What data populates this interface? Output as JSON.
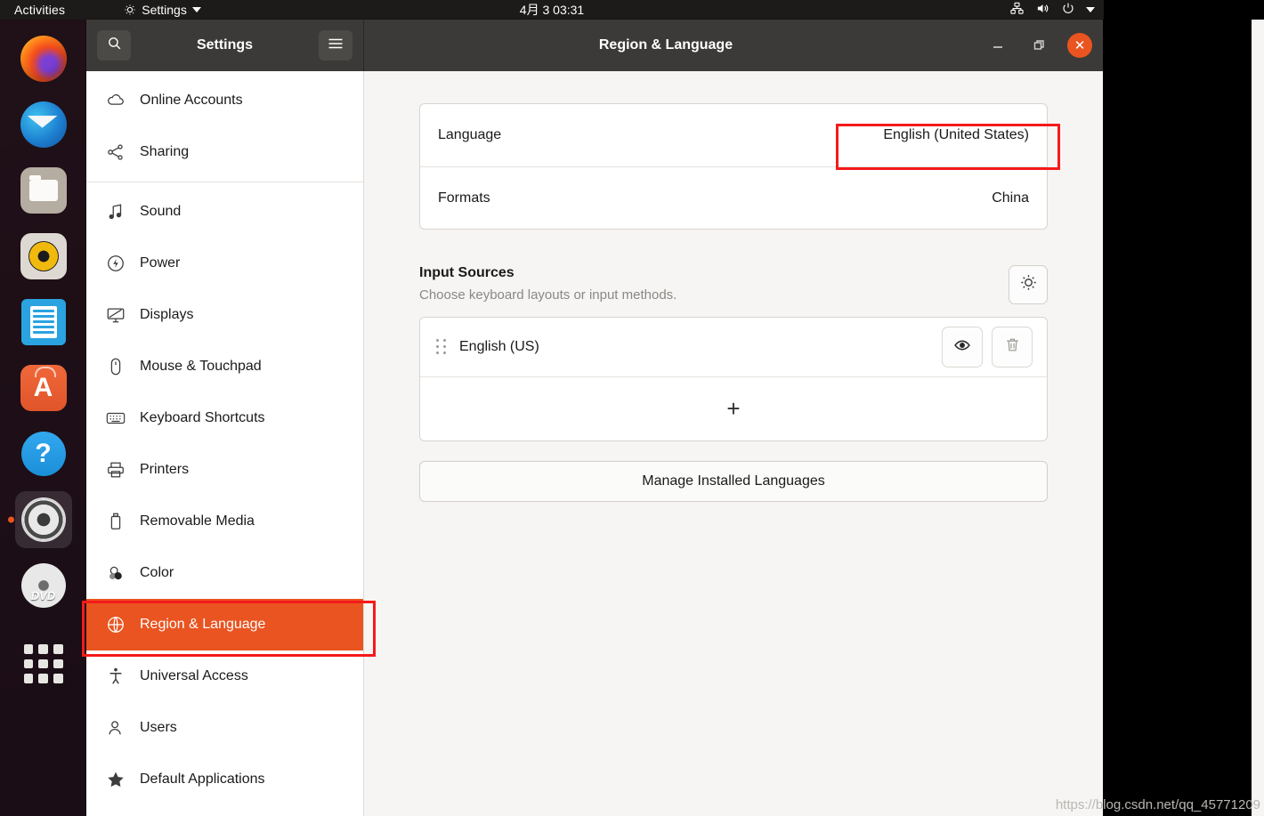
{
  "topbar": {
    "activities": "Activities",
    "app_menu": "Settings",
    "clock": "4月 3  03:31",
    "icons": [
      "network-icon",
      "volume-icon",
      "power-icon",
      "caret-down-icon"
    ]
  },
  "dock": {
    "items": [
      {
        "name": "firefox",
        "label": "Firefox",
        "active": false
      },
      {
        "name": "thunderbird",
        "label": "Thunderbird Mail",
        "active": false
      },
      {
        "name": "files",
        "label": "Files",
        "active": false
      },
      {
        "name": "rhythmbox",
        "label": "Rhythmbox",
        "active": false
      },
      {
        "name": "libreoffice-writer",
        "label": "LibreOffice Writer",
        "active": false
      },
      {
        "name": "ubuntu-software",
        "label": "Ubuntu Software",
        "active": false
      },
      {
        "name": "help",
        "label": "Help",
        "active": false
      },
      {
        "name": "settings",
        "label": "Settings",
        "active": true
      },
      {
        "name": "dvd",
        "label": "DVD",
        "active": false
      },
      {
        "name": "show-applications",
        "label": "Show Applications",
        "active": false
      }
    ],
    "dvd_label": "DVD",
    "help_label": "?",
    "software_label": "A"
  },
  "window": {
    "sidebar_title": "Settings",
    "title": "Region & Language",
    "search_icon": "search-icon",
    "menu_icon": "hamburger-menu-icon",
    "controls": {
      "minimize": "−",
      "maximize": "restore-icon",
      "close": "✕"
    }
  },
  "sidebar": {
    "items": [
      {
        "label": "Online Accounts",
        "icon": "cloud-icon",
        "selected": false
      },
      {
        "label": "Sharing",
        "icon": "share-nodes-icon",
        "selected": false
      },
      {
        "label": "Sound",
        "icon": "music-note-icon",
        "selected": false
      },
      {
        "label": "Power",
        "icon": "power-bolt-icon",
        "selected": false
      },
      {
        "label": "Displays",
        "icon": "monitor-icon",
        "selected": false
      },
      {
        "label": "Mouse & Touchpad",
        "icon": "mouse-icon",
        "selected": false
      },
      {
        "label": "Keyboard Shortcuts",
        "icon": "keyboard-icon",
        "selected": false
      },
      {
        "label": "Printers",
        "icon": "printer-icon",
        "selected": false
      },
      {
        "label": "Removable Media",
        "icon": "usb-drive-icon",
        "selected": false
      },
      {
        "label": "Color",
        "icon": "color-circles-icon",
        "selected": false
      },
      {
        "label": "Region & Language",
        "icon": "globe-icon",
        "selected": true
      },
      {
        "label": "Universal Access",
        "icon": "accessibility-icon",
        "selected": false
      },
      {
        "label": "Users",
        "icon": "user-icon",
        "selected": false
      },
      {
        "label": "Default Applications",
        "icon": "star-icon",
        "selected": false
      }
    ],
    "separator_after_index": 1
  },
  "main": {
    "language_row": {
      "label": "Language",
      "value": "English (United States)"
    },
    "formats_row": {
      "label": "Formats",
      "value": "China"
    },
    "input_sources": {
      "title": "Input Sources",
      "subtitle": "Choose keyboard layouts or input methods.",
      "options_icon": "gear-icon",
      "entries": [
        {
          "label": "English (US)",
          "preview_icon": "eye-icon",
          "remove_icon": "trash-icon"
        }
      ],
      "add_label": "+"
    },
    "manage_button": "Manage Installed Languages"
  },
  "annotations": {
    "color": "#f51a1a",
    "boxes": [
      {
        "name": "language-value-highlight"
      },
      {
        "name": "region-language-sidebar-highlight"
      }
    ]
  },
  "watermark": "https://blog.csdn.net/qq_45771209"
}
